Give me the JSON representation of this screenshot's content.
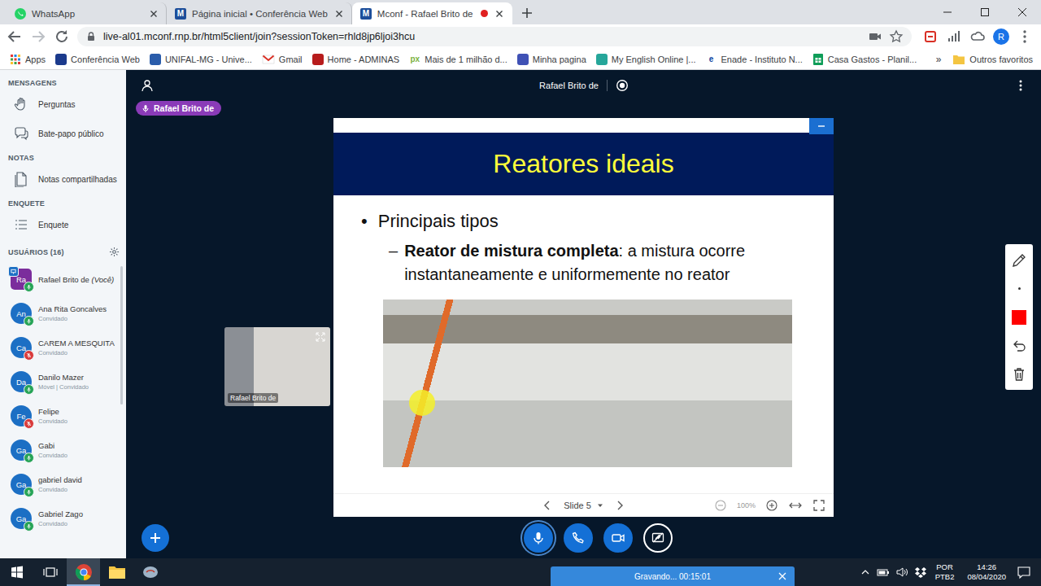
{
  "browser": {
    "tabs": [
      {
        "label": "WhatsApp",
        "selected": false,
        "kind": "whatsapp",
        "recording": false
      },
      {
        "label": "Página inicial • Conferência Web",
        "selected": false,
        "kind": "mconf",
        "favicon_text": "M",
        "recording": false
      },
      {
        "label": "Mconf - Rafael Brito de",
        "selected": true,
        "kind": "mconf",
        "favicon_text": "M",
        "recording": true
      }
    ],
    "url": "live-al01.mconf.rnp.br/html5client/join?sessionToken=rhld8jp6ljoi3hcu",
    "profile_initial": "R",
    "bookmarks": [
      {
        "label": "Apps",
        "kind": "apps",
        "color": "#e53935"
      },
      {
        "label": "Conferência Web",
        "kind": "site",
        "color": "#1b3a8c"
      },
      {
        "label": "UNIFAL-MG - Unive...",
        "kind": "site",
        "color": "#2a5caa"
      },
      {
        "label": "Gmail",
        "kind": "gmail",
        "color": "#d93025"
      },
      {
        "label": "Home - ADMINAS",
        "kind": "site",
        "color": "#b71c1c"
      },
      {
        "label": "Mais de 1 milhão d...",
        "kind": "text",
        "color": "#7cb342",
        "favicon_text": "px"
      },
      {
        "label": "Minha pagina",
        "kind": "site",
        "color": "#3f51b5"
      },
      {
        "label": "My English Online |...",
        "kind": "site",
        "color": "#26a69a"
      },
      {
        "label": "Enade - Instituto N...",
        "kind": "text",
        "color": "#0d47a1",
        "favicon_text": "e"
      },
      {
        "label": "Casa Gastos - Planil...",
        "kind": "sheets",
        "color": "#0f9d58"
      }
    ],
    "bookmarks_more": "»",
    "other_bookmarks": "Outros favoritos"
  },
  "sidebar": {
    "sections": [
      {
        "title": "MENSAGENS",
        "items": [
          {
            "label": "Perguntas",
            "kind": "hand"
          },
          {
            "label": "Bate-papo público",
            "kind": "chat"
          }
        ]
      },
      {
        "title": "NOTAS",
        "items": [
          {
            "label": "Notas compartilhadas",
            "kind": "note"
          }
        ]
      },
      {
        "title": "ENQUETE",
        "items": [
          {
            "label": "Enquete",
            "kind": "poll"
          }
        ]
      }
    ],
    "users_title": "USUÁRIOS (16)",
    "users": [
      {
        "initials": "Ra",
        "name": "Rafael Brito de",
        "suffix": "(Você)",
        "presenter": true,
        "muted": false,
        "color": "#7b2d9c"
      },
      {
        "initials": "An",
        "name": "Ana Rita Goncalves",
        "role": "Convidado",
        "presenter": false,
        "muted": false,
        "color": "#1c6fc4"
      },
      {
        "initials": "Ca",
        "name": "CAREM A MESQUITA",
        "role": "Convidado",
        "presenter": false,
        "muted": true,
        "color": "#1c6fc4"
      },
      {
        "initials": "Da",
        "name": "Danilo Mazer",
        "role": "Móvel | Convidado",
        "presenter": false,
        "muted": false,
        "color": "#1c6fc4"
      },
      {
        "initials": "Fe",
        "name": "Felipe",
        "role": "Convidado",
        "presenter": false,
        "muted": true,
        "color": "#1c6fc4"
      },
      {
        "initials": "Ga",
        "name": "Gabi",
        "role": "Convidado",
        "presenter": false,
        "muted": false,
        "color": "#1c6fc4"
      },
      {
        "initials": "Ga",
        "name": "gabriel david",
        "role": "Convidado",
        "presenter": false,
        "muted": false,
        "color": "#1c6fc4"
      },
      {
        "initials": "Ga",
        "name": "Gabriel Zago",
        "role": "Convidado",
        "presenter": false,
        "muted": false,
        "color": "#1c6fc4"
      }
    ]
  },
  "meeting": {
    "title": "Rafael Brito de",
    "talking": "Rafael Brito de",
    "webcam_label": "Rafael Brito de",
    "slide": {
      "title": "Reatores ideais",
      "bullet_mark": "•",
      "bullet": "Principais tipos",
      "sub_dash": "–",
      "sub_bold": "Reator de mistura completa",
      "sub_rest": ": a mistura ocorre instantaneamente e uniformemente no reator",
      "page": "Slide 5",
      "zoom": "100%"
    },
    "annotation_tools": [
      {
        "kind": "pencil"
      },
      {
        "kind": "thickness"
      },
      {
        "kind": "color",
        "color": "#ff0000"
      },
      {
        "kind": "undo"
      },
      {
        "kind": "clear"
      }
    ],
    "actions": [
      {
        "kind": "mic",
        "active": true
      },
      {
        "kind": "phone",
        "active": false
      },
      {
        "kind": "camera",
        "active": false
      },
      {
        "kind": "screen",
        "active": false
      }
    ],
    "recording": {
      "label": "Gravando... 00:15:01"
    }
  },
  "taskbar": {
    "apps": [
      {
        "kind": "task-view",
        "selected": false
      },
      {
        "kind": "chrome",
        "selected": true
      },
      {
        "kind": "explorer",
        "selected": false
      },
      {
        "kind": "app",
        "selected": false
      }
    ],
    "lang": "POR",
    "layout": "PTB2",
    "time": "14:26",
    "date": "08/04/2020"
  }
}
